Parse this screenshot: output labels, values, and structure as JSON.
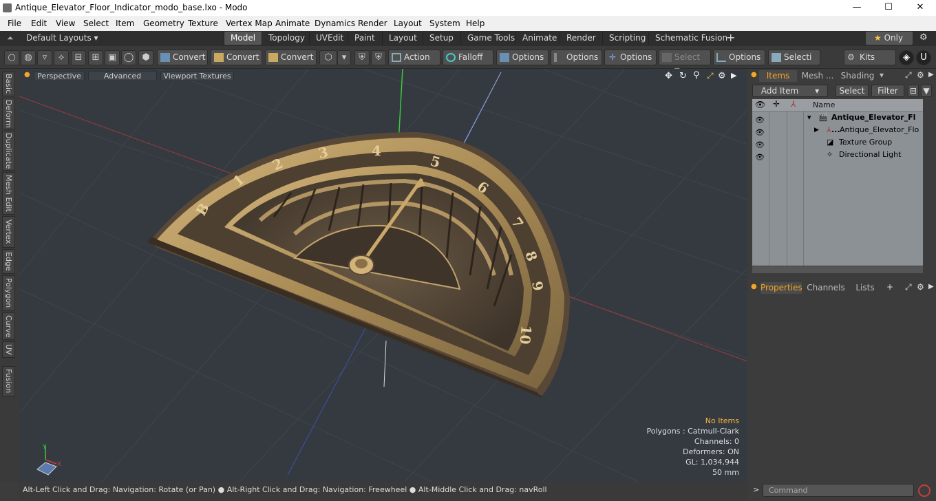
{
  "window": {
    "title": "Antique_Elevator_Floor_Indicator_modo_base.lxo - Modo",
    "min": "—",
    "max": "☐",
    "close": "✕"
  },
  "menu": [
    "File",
    "Edit",
    "View",
    "Select",
    "Item",
    "Geometry",
    "Texture",
    "Vertex Map",
    "Animate",
    "Dynamics",
    "Render",
    "Layout",
    "System",
    "Help"
  ],
  "layout": {
    "preset": "Default Layouts ▾",
    "tabs": [
      "Model",
      "Topology",
      "UVEdit",
      "Paint",
      "Layout",
      "Setup",
      "Game Tools",
      "Animate",
      "Render",
      "Scripting",
      "Schematic Fusion"
    ],
    "active": "Model",
    "add": "+",
    "only": "Only",
    "star": "★",
    "gear": "⚙"
  },
  "toolbar": {
    "convert1": "Convert",
    "convert2": "Convert",
    "convert3": "Convert",
    "action": "Action",
    "falloff": "Falloff",
    "options1": "Options",
    "options2": "Options",
    "options3": "Options",
    "select_t": "Select T...",
    "options4": "Options",
    "selecti": "Selecti ...",
    "kits": "Kits"
  },
  "left_tabs": [
    "Basic",
    "Deform",
    "Duplicate",
    "Mesh Edit",
    "Vertex",
    "Edge",
    "Polygon",
    "Curve",
    "UV",
    "Fusion"
  ],
  "viewport": {
    "perspective": "Perspective",
    "advanced": "Advanced",
    "textures": "Viewport Textures",
    "dial_numbers": [
      "B",
      "1",
      "2",
      "3",
      "4",
      "5",
      "6",
      "7",
      "8",
      "9",
      "10"
    ],
    "axis_y": "Y",
    "axis_x": "X",
    "stats": {
      "no_items": "No Items",
      "polygons": "Polygons : Catmull-Clark",
      "channels": "Channels: 0",
      "deformers": "Deformers: ON",
      "gl": "GL: 1,034,944",
      "size": "50 mm"
    }
  },
  "status": "Alt-Left Click and Drag: Navigation: Rotate (or Pan) ● Alt-Right Click and Drag: Navigation: Freewheel ● Alt-Middle Click and Drag: navRoll",
  "items_panel": {
    "tabs": [
      "Items",
      "Mesh ...",
      "Shading"
    ],
    "add_item": "Add Item",
    "select": "Select",
    "filter": "Filter",
    "name_col": "Name",
    "rows": [
      {
        "label": "Antique_Elevator_Fl ...",
        "bold": true
      },
      {
        "label": "Antique_Elevator_Flo ..."
      },
      {
        "label": "Texture Group"
      },
      {
        "label": "Directional Light"
      }
    ]
  },
  "props_panel": {
    "tabs": [
      "Properties",
      "Channels",
      "Lists"
    ],
    "add": "+"
  },
  "command": {
    "placeholder": "Command",
    "prompt": ">"
  },
  "colors": {
    "accent": "#f5a623",
    "viewport_bg": "#353a40",
    "brass": "#c9a86a"
  }
}
